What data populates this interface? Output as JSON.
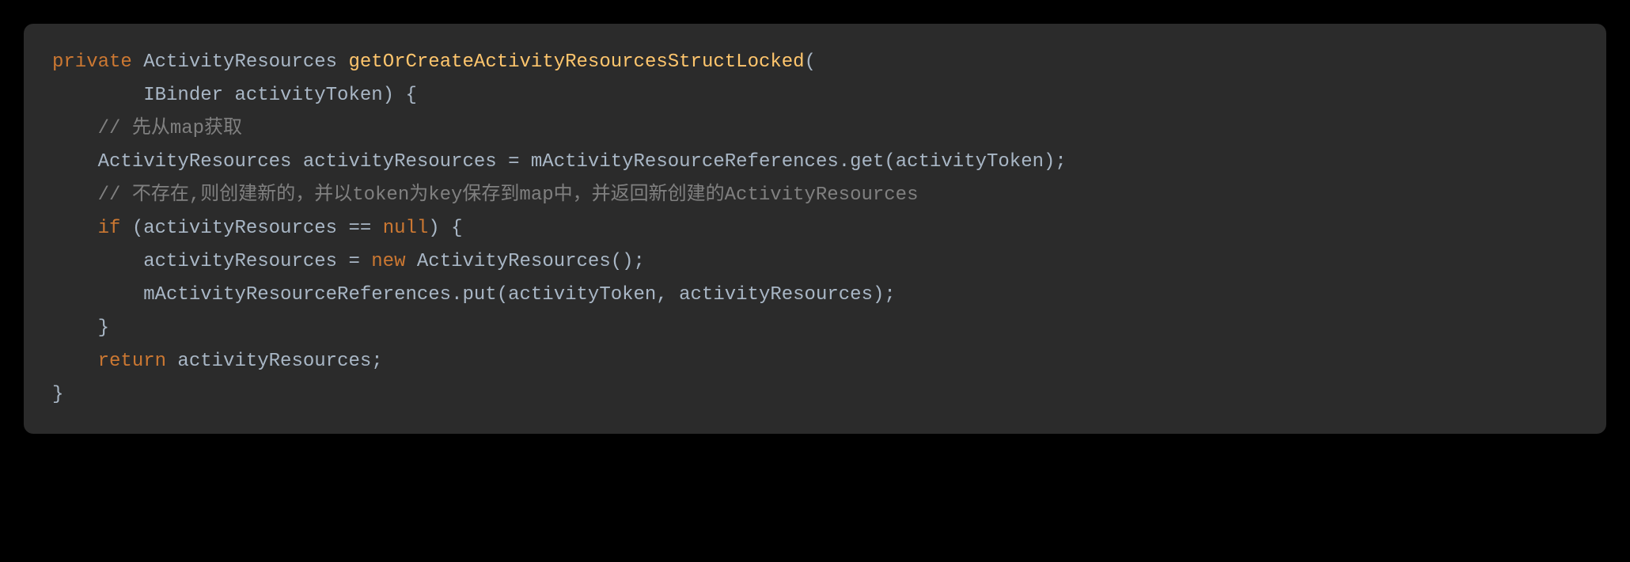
{
  "code": {
    "line1": {
      "kw_private": "private",
      "type1": " ActivityResources ",
      "method": "getOrCreateActivityResourcesStructLocked",
      "paren": "("
    },
    "line2": {
      "indent": "        ",
      "text": "IBinder activityToken) {"
    },
    "line3": {
      "indent": "    ",
      "comment": "// 先从map获取"
    },
    "line4": {
      "indent": "    ",
      "text": "ActivityResources activityResources = mActivityResourceReferences.get(activityToken);"
    },
    "line5": {
      "indent": "    ",
      "comment": "// 不存在,则创建新的，并以token为key保存到map中，并返回新创建的ActivityResources"
    },
    "line6": {
      "indent": "    ",
      "kw_if": "if",
      "text1": " (activityResources == ",
      "kw_null": "null",
      "text2": ") {"
    },
    "line7": {
      "indent": "        ",
      "text1": "activityResources = ",
      "kw_new": "new",
      "text2": " ActivityResources();"
    },
    "line8": {
      "indent": "        ",
      "text": "mActivityResourceReferences.put(activityToken, activityResources);"
    },
    "line9": {
      "indent": "    ",
      "text": "}"
    },
    "line10": {
      "indent": "    ",
      "kw_return": "return",
      "text": " activityResources;"
    },
    "line11": {
      "text": "}"
    }
  }
}
